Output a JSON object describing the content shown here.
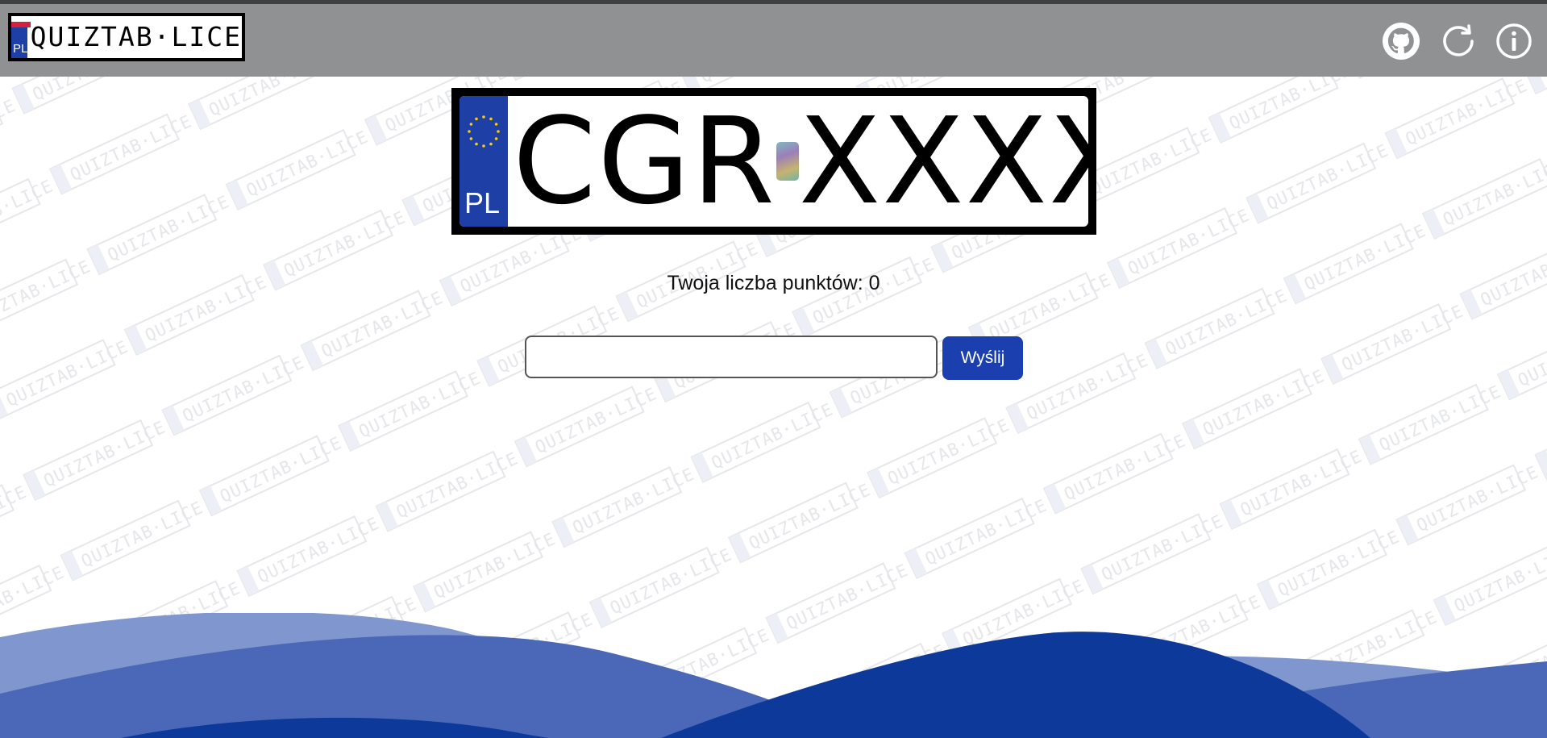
{
  "header": {
    "logo": {
      "text": "QUIZTAB·LICE",
      "country": "PL"
    },
    "icons": [
      "github-icon",
      "refresh-icon",
      "info-icon"
    ]
  },
  "plate": {
    "country": "PL",
    "prefix": "CGR",
    "suffix": "XXXX"
  },
  "score": {
    "text": "Twoja liczba punktów: 0"
  },
  "form": {
    "input_value": "",
    "submit_label": "Wyślij"
  },
  "colors": {
    "header_bg": "#8f9193",
    "plate_band": "#1e3fa6",
    "button": "#1c3fb0",
    "wave_light": "#8096cf",
    "wave_mid": "#4a68b7",
    "wave_dark": "#0d3a9a"
  }
}
